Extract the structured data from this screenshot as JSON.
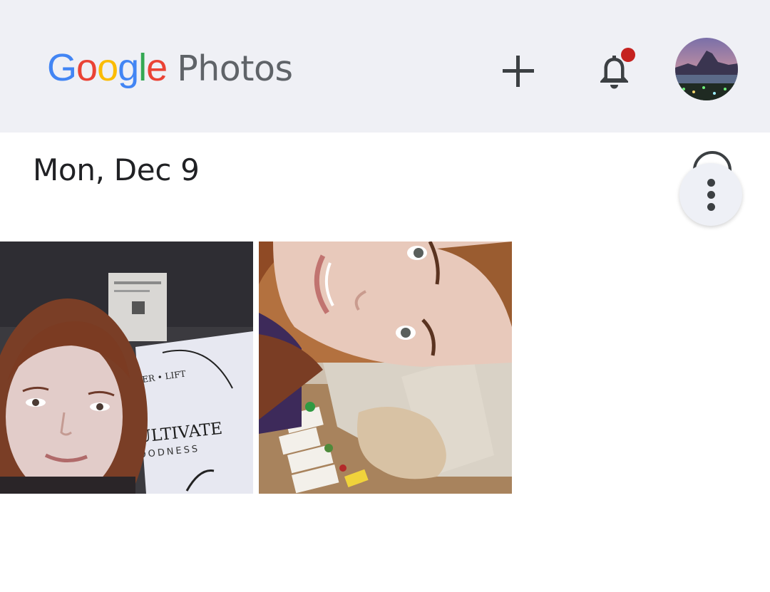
{
  "app": {
    "logo_google": [
      "G",
      "o",
      "o",
      "g",
      "l",
      "e"
    ],
    "logo_google_colors": [
      "#4285F4",
      "#EA4335",
      "#FBBC05",
      "#4285F4",
      "#34A853",
      "#EA4335"
    ],
    "logo_photos": "Photos"
  },
  "toolbar": {
    "add_icon": "plus-icon",
    "notifications_icon": "bell-icon",
    "notification_dot_color": "#c5221f",
    "avatar_icon": "profile-avatar"
  },
  "timeline": {
    "date_label": "Mon, Dec 9",
    "select_icon": "select-circle-icon",
    "more_icon": "more-vert-icon"
  },
  "photos": [
    {
      "id_label": "photo-1",
      "sign_text_top": "ER • LIFT",
      "sign_text_main": "CULTIVATE",
      "sign_text_sub": "GOODNESS"
    },
    {
      "id_label": "photo-2"
    }
  ]
}
